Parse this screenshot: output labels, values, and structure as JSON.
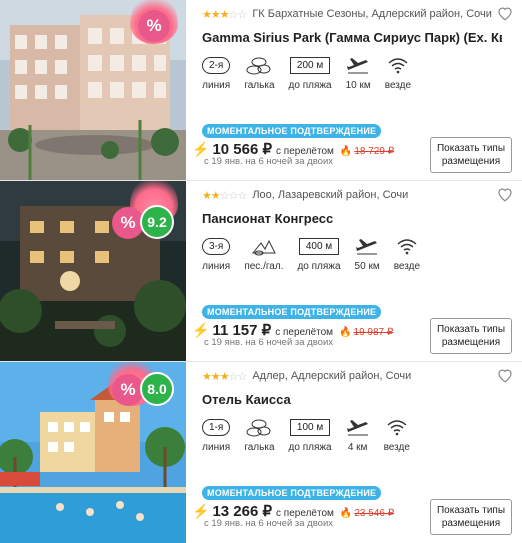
{
  "hotels": [
    {
      "stars": 3,
      "location": "ГК Бархатные Сезоны, Адлерский район, Сочи",
      "name": "Gamma Sirius Park (Гамма Сириус Парк) (Ex. Кв",
      "discount_badge": "%",
      "rating": "",
      "features": [
        {
          "value": "2-я",
          "label": "линия",
          "icon": "line-icon"
        },
        {
          "value": "",
          "label": "галька",
          "icon": "pebbles-icon"
        },
        {
          "value": "200 м",
          "label": "до пляжа",
          "icon": "distance-icon"
        },
        {
          "value": "",
          "label": "10 км",
          "icon": "plane-icon"
        },
        {
          "value": "",
          "label": "везде",
          "icon": "wifi-icon"
        }
      ],
      "confirm": "МОМЕНТАЛЬНОЕ ПОДТВЕРЖДЕНИЕ",
      "price": "10 566 ₽",
      "with_flight": "с перелётом",
      "old_price": "18 729 ₽",
      "dates": "с 19 янв. на 6 ночей за двоих",
      "button": "Показать типы размещения"
    },
    {
      "stars": 2,
      "location": "Лоо, Лазаревский район, Сочи",
      "name": "Пансионат Конгресс",
      "discount_badge": "%",
      "rating": "9.2",
      "features": [
        {
          "value": "3-я",
          "label": "линия",
          "icon": "line-icon"
        },
        {
          "value": "",
          "label": "пес./гал.",
          "icon": "sand-pebbles-icon"
        },
        {
          "value": "400 м",
          "label": "до пляжа",
          "icon": "distance-icon"
        },
        {
          "value": "",
          "label": "50 км",
          "icon": "plane-icon"
        },
        {
          "value": "",
          "label": "везде",
          "icon": "wifi-icon"
        }
      ],
      "confirm": "МОМЕНТАЛЬНОЕ ПОДТВЕРЖДЕНИЕ",
      "price": "11 157 ₽",
      "with_flight": "с перелётом",
      "old_price": "19 987 ₽",
      "dates": "с 19 янв. на 6 ночей за двоих",
      "button": "Показать типы размещения"
    },
    {
      "stars": 3,
      "location": "Адлер, Адлерский район, Сочи",
      "name": "Отель Каисса",
      "discount_badge": "%",
      "rating": "8.0",
      "features": [
        {
          "value": "1-я",
          "label": "линия",
          "icon": "line-icon"
        },
        {
          "value": "",
          "label": "галька",
          "icon": "pebbles-icon"
        },
        {
          "value": "100 м",
          "label": "до пляжа",
          "icon": "distance-icon"
        },
        {
          "value": "",
          "label": "4 км",
          "icon": "plane-icon"
        },
        {
          "value": "",
          "label": "везде",
          "icon": "wifi-icon"
        }
      ],
      "confirm": "МОМЕНТАЛЬНОЕ ПОДТВЕРЖДЕНИЕ",
      "price": "13 266 ₽",
      "with_flight": "с перелётом",
      "old_price": "23 546 ₽",
      "dates": "с 19 янв. на 6 ночей за двоих",
      "button": "Показать типы размещения"
    }
  ],
  "colors": {
    "confirm_bg": "#3db3e8",
    "old_price": "#e0412f",
    "rating_bg": "#2db34a",
    "badge_bg": "#e8588a",
    "star": "#f2b01e"
  }
}
